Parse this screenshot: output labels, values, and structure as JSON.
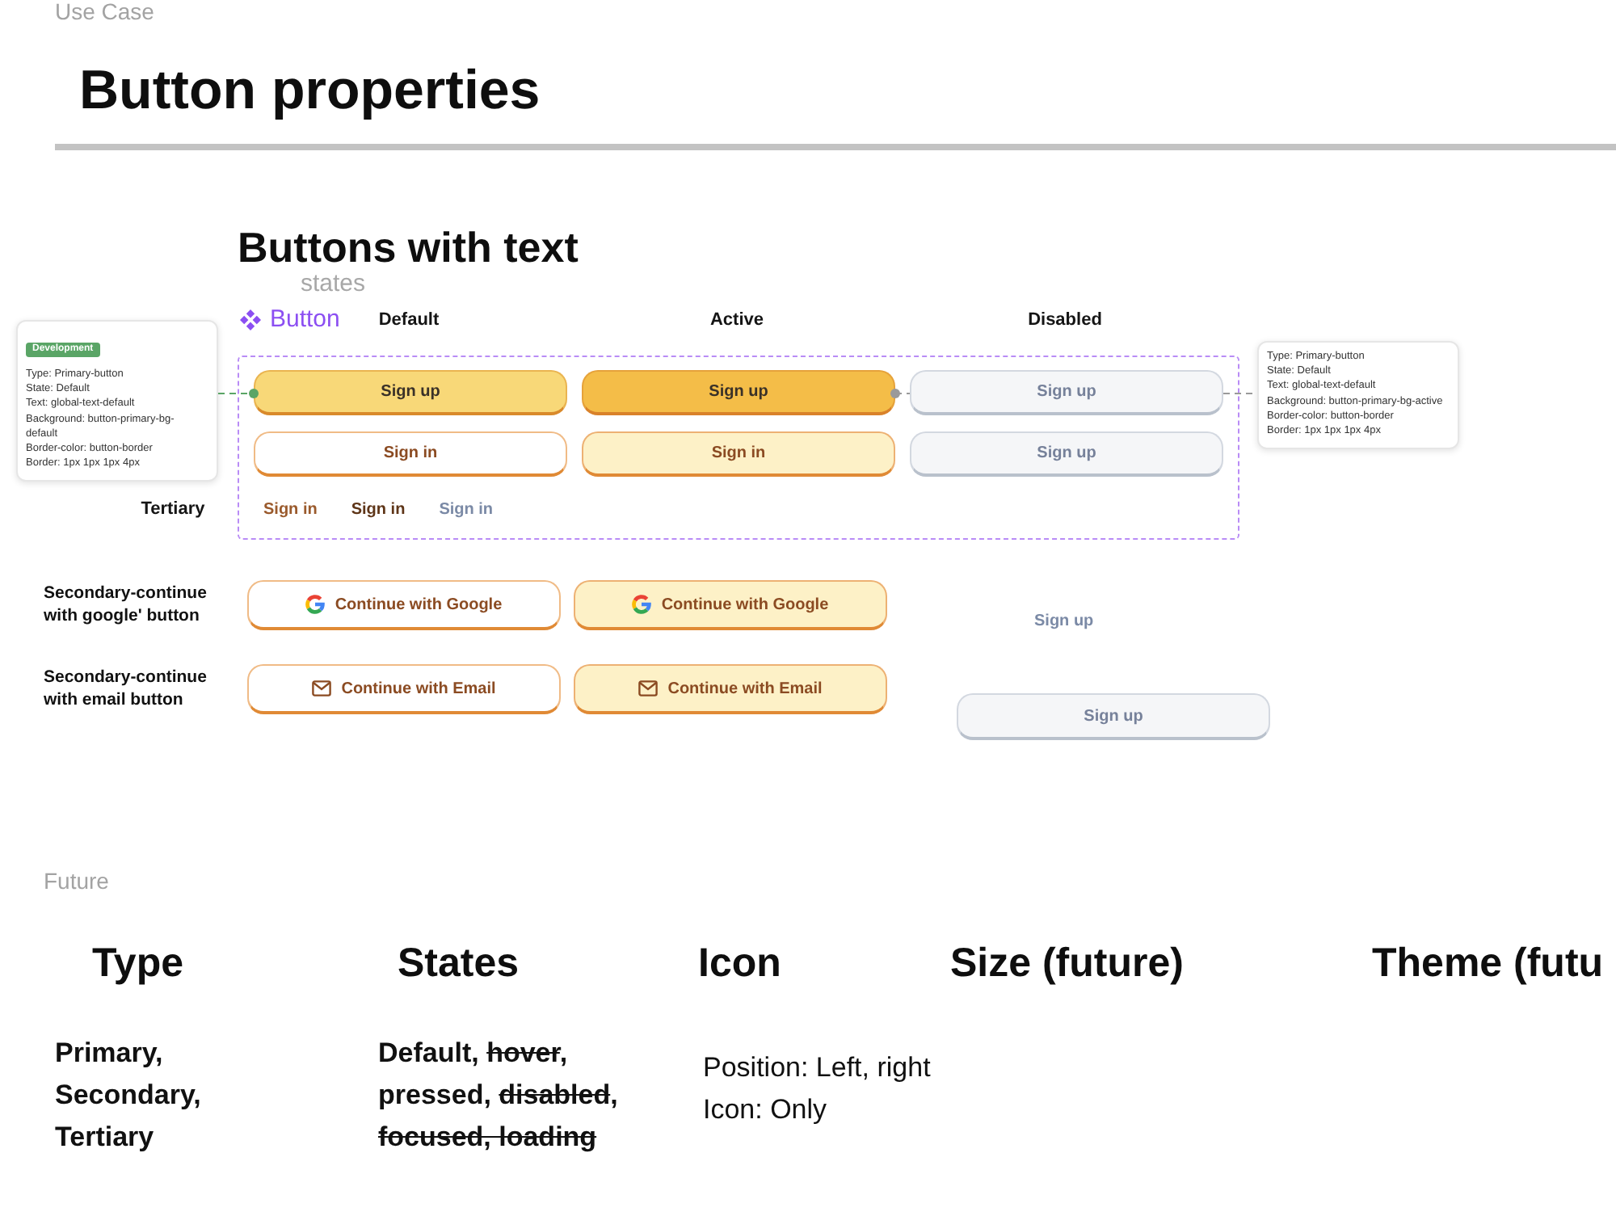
{
  "header": {
    "section_label": "Use Case",
    "title": "Button properties"
  },
  "button_frame": {
    "title": "Buttons with text",
    "subtitle": "states",
    "component_label": "Button",
    "columns": [
      "Default",
      "Active",
      "Disabled"
    ],
    "rows": [
      {
        "kind": "primary",
        "buttons": [
          {
            "label": "Sign up",
            "active": false,
            "disabled": false
          },
          {
            "label": "Sign up",
            "active": true,
            "disabled": false
          },
          {
            "label": "Sign up",
            "active": false,
            "disabled": true
          }
        ]
      },
      {
        "kind": "secondary",
        "buttons": [
          {
            "label": "Sign in",
            "active": false,
            "disabled": false
          },
          {
            "label": "Sign in",
            "active": true,
            "disabled": false
          },
          {
            "label": "Sign up",
            "active": false,
            "disabled": true
          }
        ]
      },
      {
        "kind": "tertiary",
        "label": "Tertiary",
        "buttons": [
          {
            "label": "Sign in",
            "active": false,
            "disabled": false
          },
          {
            "label": "Sign in",
            "active": true,
            "disabled": false
          },
          {
            "label": "Sign in",
            "active": false,
            "disabled": true
          }
        ]
      }
    ]
  },
  "annotations": [
    {
      "badge": "Development",
      "color": "#5aa566",
      "lines": [
        "Type: Primary-button",
        "State: Default",
        "Text: global-text-default",
        "Background: button-primary-bg-default",
        "Border-color: button-border",
        "Border: 1px 1px 1px 4px"
      ]
    },
    {
      "color": "#9a9a9a",
      "lines": [
        "Type: Primary-button",
        "State: Default",
        "Text: global-text-default",
        "Background: button-primary-bg-active",
        "Border-color: button-border",
        "Border: 1px 1px 1px 4px"
      ]
    }
  ],
  "social_rows": [
    {
      "kind": "google",
      "label": "Secondary-continue with google' button",
      "buttons": [
        {
          "label": "Continue with Google",
          "active": false,
          "disabled": false
        },
        {
          "label": "Continue with Google",
          "active": true,
          "disabled": false
        }
      ],
      "extra": {
        "kind": "tertiary",
        "label": "Sign up",
        "active": false,
        "disabled": true
      }
    },
    {
      "kind": "email",
      "label": "Secondary-continue with email button",
      "buttons": [
        {
          "label": "Continue with Email",
          "active": false,
          "disabled": false
        },
        {
          "label": "Continue with Email",
          "active": true,
          "disabled": false
        }
      ],
      "extra": {
        "kind": "secondary",
        "label": "Sign up",
        "active": false,
        "disabled": true
      }
    }
  ],
  "future": {
    "section_label": "Future",
    "columns": [
      {
        "heading": "Type",
        "kind": "paragraph",
        "text": "Primary, Secondary, Tertiary"
      },
      {
        "heading": "States",
        "kind": "segments",
        "segments": [
          {
            "text": "Default, ",
            "struck": false
          },
          {
            "text": "hover",
            "struck": true
          },
          {
            "text": ", pressed, ",
            "struck": false
          },
          {
            "text": "disabled",
            "struck": true
          },
          {
            "text": ", ",
            "struck": false
          },
          {
            "text": "focused, loading",
            "struck": true
          }
        ]
      },
      {
        "heading": "Icon",
        "kind": "lines",
        "lines": [
          "Position: Left, right",
          "Icon: Only"
        ]
      },
      {
        "heading": "Size (future)"
      },
      {
        "heading": "Theme (futu"
      }
    ]
  }
}
